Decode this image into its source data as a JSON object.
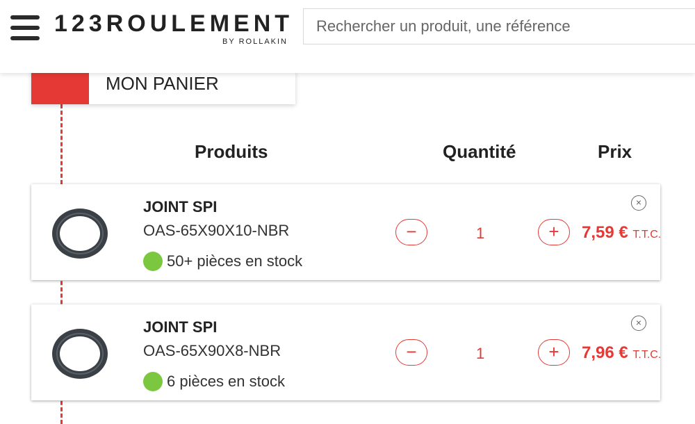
{
  "header": {
    "logo_text": "123ROULEMENT",
    "logo_sub": "BY ROLLAKIN",
    "search_placeholder": "Rechercher un produit, une référence"
  },
  "cart": {
    "title": "MON PANIER",
    "columns": {
      "products": "Produits",
      "quantity": "Quantité",
      "price": "Prix"
    },
    "items": [
      {
        "name": "JOINT SPI",
        "reference": "OAS-65X90X10-NBR",
        "stock": "50+ pièces en stock",
        "quantity": "1",
        "price": "7,59 €",
        "price_suffix": "T.T.C."
      },
      {
        "name": "JOINT SPI",
        "reference": "OAS-65X90X8-NBR",
        "stock": "6 pièces en stock",
        "quantity": "1",
        "price": "7,96 €",
        "price_suffix": "T.T.C."
      }
    ],
    "minus_symbol": "−",
    "plus_symbol": "+",
    "remove_symbol": "×"
  },
  "colors": {
    "accent": "#e53935",
    "stock": "#7cc740",
    "text": "#222222"
  }
}
